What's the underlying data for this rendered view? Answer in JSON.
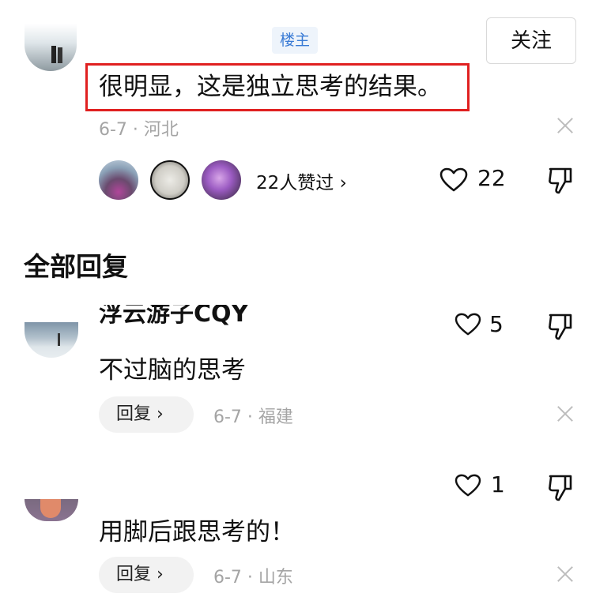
{
  "post": {
    "badge": "楼主",
    "follow_label": "关注",
    "text": "很明显，这是独立思考的结果。",
    "meta": "6-7 · 河北",
    "liked_summary": "22人赞过 ›",
    "like_count": "22"
  },
  "section_title": "全部回复",
  "replies": [
    {
      "username": "浮云游子CQY",
      "text": "不过脑的思考",
      "reply_label": "回复 ›",
      "meta": "6-7 · 福建",
      "like_count": "5"
    },
    {
      "username": "",
      "text": "用脚后跟思考的！",
      "reply_label": "回复 ›",
      "meta": "6-7 · 山东",
      "like_count": "1"
    }
  ],
  "icons": {
    "like": "heart-outline-icon",
    "dislike": "thumbs-down-icon",
    "close": "close-icon"
  },
  "colors": {
    "badge_text": "#3a7bd5",
    "badge_bg": "#eef4fb",
    "highlight": "#e02020",
    "meta": "#a4a4a4"
  }
}
